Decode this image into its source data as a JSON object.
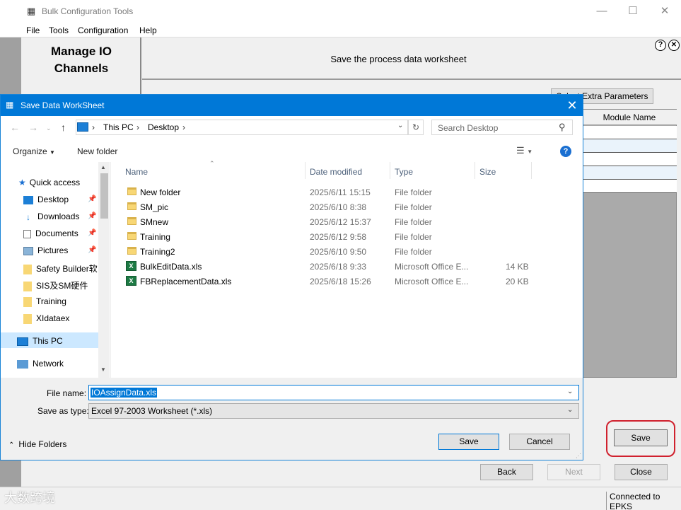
{
  "app": {
    "title": "Bulk Configuration Tools",
    "menu": [
      "File",
      "Tools",
      "Configuration",
      "Help"
    ],
    "manage_title": "Manage IO Channels",
    "header": "Save the process data worksheet",
    "extra_params_btn": "Select Extra Parameters",
    "grid_header": "Module Name",
    "save_btn": "Save",
    "back_btn": "Back",
    "next_btn": "Next",
    "close_btn": "Close",
    "status": "Connected to EPKS",
    "watermark": "大数跨境"
  },
  "dialog": {
    "title": "Save Data WorkSheet",
    "breadcrumb": [
      "This PC",
      "Desktop"
    ],
    "search_placeholder": "Search Desktop",
    "organize": "Organize",
    "new_folder": "New folder",
    "nav": {
      "quick_access": "Quick access",
      "items": [
        {
          "label": "Desktop",
          "pinned": true,
          "icon": "desktop-icon"
        },
        {
          "label": "Downloads",
          "pinned": true,
          "icon": "download-icon"
        },
        {
          "label": "Documents",
          "pinned": true,
          "icon": "document-icon"
        },
        {
          "label": "Pictures",
          "pinned": true,
          "icon": "picture-icon"
        },
        {
          "label": "Safety Builder软",
          "pinned": false,
          "icon": "folder-icon"
        },
        {
          "label": "SIS及SM硬件",
          "pinned": false,
          "icon": "folder-icon"
        },
        {
          "label": "Training",
          "pinned": false,
          "icon": "folder-icon"
        },
        {
          "label": "XIdataex",
          "pinned": false,
          "icon": "folder-icon"
        }
      ],
      "this_pc": "This PC",
      "network": "Network"
    },
    "columns": {
      "name": "Name",
      "date": "Date modified",
      "type": "Type",
      "size": "Size"
    },
    "files": [
      {
        "name": "New folder",
        "date": "2025/6/11 15:15",
        "type": "File folder",
        "size": "",
        "kind": "folder"
      },
      {
        "name": "SM_pic",
        "date": "2025/6/10 8:38",
        "type": "File folder",
        "size": "",
        "kind": "folder"
      },
      {
        "name": "SMnew",
        "date": "2025/6/12 15:37",
        "type": "File folder",
        "size": "",
        "kind": "folder"
      },
      {
        "name": "Training",
        "date": "2025/6/12 9:58",
        "type": "File folder",
        "size": "",
        "kind": "folder"
      },
      {
        "name": "Training2",
        "date": "2025/6/10 9:50",
        "type": "File folder",
        "size": "",
        "kind": "folder"
      },
      {
        "name": "BulkEditData.xls",
        "date": "2025/6/18 9:33",
        "type": "Microsoft Office E...",
        "size": "14 KB",
        "kind": "xls"
      },
      {
        "name": "FBReplacementData.xls",
        "date": "2025/6/18 15:26",
        "type": "Microsoft Office E...",
        "size": "20 KB",
        "kind": "xls"
      }
    ],
    "file_name_label": "File name:",
    "file_name_value": "IOAssignData.xls",
    "save_as_type_label": "Save as type:",
    "save_as_type_value": "Excel 97-2003 Worksheet (*.xls)",
    "hide_folders": "Hide Folders",
    "save": "Save",
    "cancel": "Cancel"
  }
}
